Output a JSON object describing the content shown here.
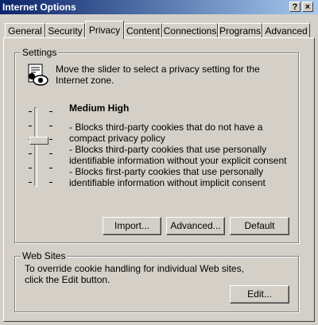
{
  "window": {
    "title": "Internet Options",
    "help_label": "?",
    "close_label": "×"
  },
  "tabs": [
    {
      "label": "General",
      "active": false
    },
    {
      "label": "Security",
      "active": false
    },
    {
      "label": "Privacy",
      "active": true
    },
    {
      "label": "Content",
      "active": false
    },
    {
      "label": "Connections",
      "active": false
    },
    {
      "label": "Programs",
      "active": false
    },
    {
      "label": "Advanced",
      "active": false
    }
  ],
  "settings": {
    "group_label": "Settings",
    "intro": "Move the slider to select a privacy setting for the Internet zone.",
    "level_name": "Medium High",
    "level_position": "3 of 6",
    "description": [
      "- Blocks third-party cookies that do not have a compact privacy policy",
      "- Blocks third-party cookies that use personally identifiable information without your explicit consent",
      "- Blocks first-party cookies that use personally identifiable information without implicit consent"
    ],
    "buttons": {
      "import": "Import...",
      "advanced": "Advanced...",
      "default": "Default"
    }
  },
  "websites": {
    "group_label": "Web Sites",
    "text": "To override cookie handling for individual Web sites, click the Edit button.",
    "edit": "Edit..."
  },
  "icons": [
    "privacy-document-eye-icon"
  ]
}
